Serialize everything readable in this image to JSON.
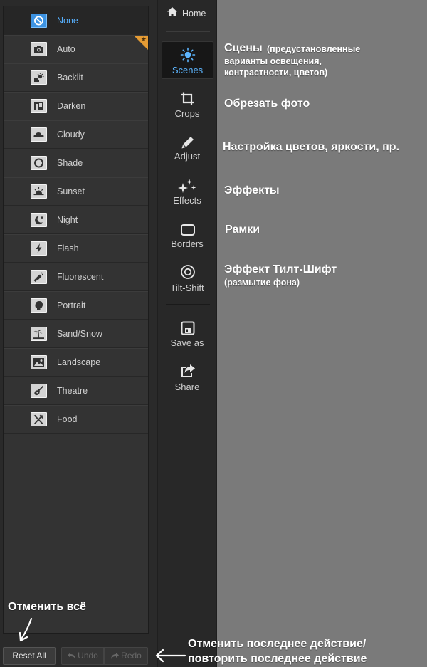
{
  "scenes": {
    "items": [
      {
        "label": "None",
        "icon": "none-icon",
        "selected": true
      },
      {
        "label": "Auto",
        "icon": "camera-icon",
        "badge": true
      },
      {
        "label": "Backlit",
        "icon": "backlit-icon"
      },
      {
        "label": "Darken",
        "icon": "darken-icon"
      },
      {
        "label": "Cloudy",
        "icon": "cloud-icon"
      },
      {
        "label": "Shade",
        "icon": "shade-icon"
      },
      {
        "label": "Sunset",
        "icon": "sunset-icon"
      },
      {
        "label": "Night",
        "icon": "night-icon"
      },
      {
        "label": "Flash",
        "icon": "flash-icon"
      },
      {
        "label": "Fluorescent",
        "icon": "fluorescent-icon"
      },
      {
        "label": "Portrait",
        "icon": "portrait-icon"
      },
      {
        "label": "Sand/Snow",
        "icon": "beach-icon"
      },
      {
        "label": "Landscape",
        "icon": "landscape-icon"
      },
      {
        "label": "Theatre",
        "icon": "guitar-icon"
      },
      {
        "label": "Food",
        "icon": "food-icon"
      }
    ]
  },
  "bottom": {
    "reset_label": "Reset All",
    "undo_label": "Undo",
    "redo_label": "Redo"
  },
  "nav": {
    "home_label": "Home",
    "items": [
      {
        "label": "Scenes",
        "icon": "sun-icon",
        "active": true
      },
      {
        "label": "Crops",
        "icon": "crop-icon"
      },
      {
        "label": "Adjust",
        "icon": "pencil-icon"
      },
      {
        "label": "Effects",
        "icon": "sparkle-icon"
      },
      {
        "label": "Borders",
        "icon": "border-icon"
      },
      {
        "label": "Tilt-Shift",
        "icon": "tilt-shift-icon"
      },
      {
        "label": "Save as",
        "icon": "save-icon"
      },
      {
        "label": "Share",
        "icon": "share-icon"
      }
    ]
  },
  "annotations": {
    "scenes_title": "Сцены",
    "scenes_desc_1": "(предустановленные",
    "scenes_desc_2": "варианты освещения,",
    "scenes_desc_3": "контрастности, цветов)",
    "crops": "Обрезать фото",
    "adjust": "Настройка цветов, яркости, пр.",
    "effects": "Эффекты",
    "borders": "Рамки",
    "tiltshift": "Эффект Тилт-Шифт",
    "tiltshift_desc": "(размытие фона)",
    "reset_all": "Отменить всё",
    "undo_redo_1": "Отменить последнее действие/",
    "undo_redo_2": "повторить последнее действие"
  },
  "colors": {
    "accent": "#3d93e2",
    "accent_text": "#56aefb",
    "badge": "#e49b34",
    "background": "#7a7a7a"
  }
}
